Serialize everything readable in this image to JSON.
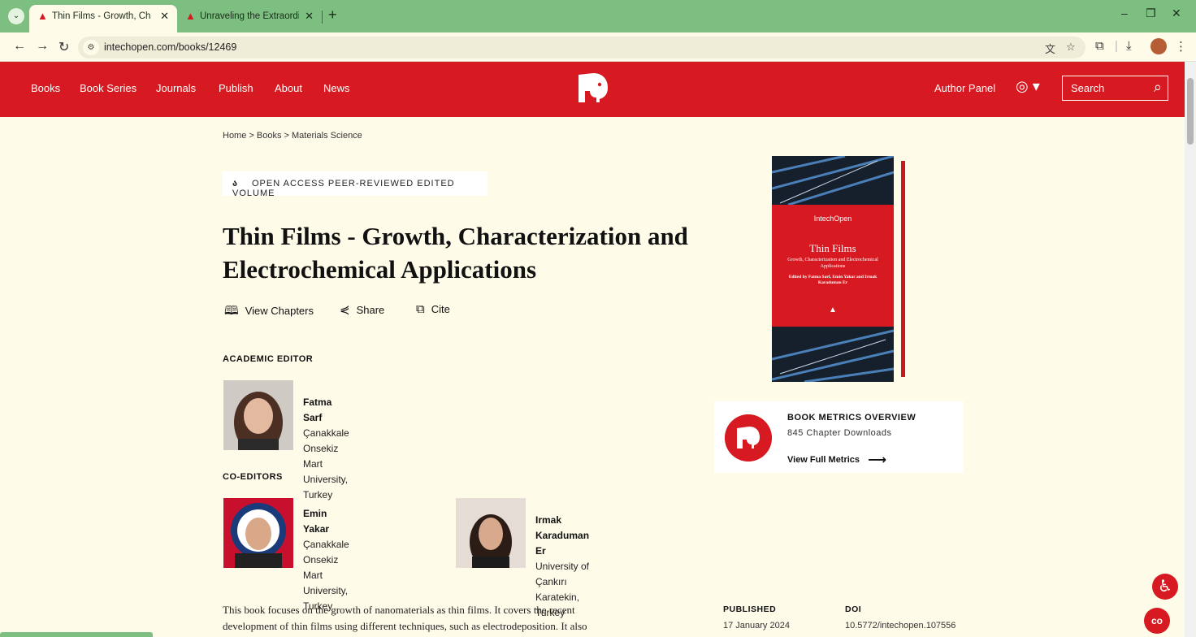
{
  "browser": {
    "tabs": [
      {
        "title": "Thin Films - Growth, Characteri",
        "active": true
      },
      {
        "title": "Unraveling the Extraordinary Ac",
        "active": false
      }
    ],
    "new_tab": "+",
    "url": "intechopen.com/books/12469",
    "window_controls": {
      "minimize": "–",
      "restore": "❐",
      "close": "✕"
    }
  },
  "site": {
    "nav": [
      "Books",
      "Book Series",
      "Journals",
      "Publish",
      "About",
      "News"
    ],
    "author_panel": "Author Panel",
    "search_placeholder": "Search"
  },
  "breadcrumb": "Home > Books > Materials Science",
  "badge": "OPEN ACCESS PEER-REVIEWED EDITED VOLUME",
  "title_line1": "Thin Films - Growth, Characterization and",
  "title_line2": "Electrochemical Applications",
  "actions": {
    "chapters": "View Chapters",
    "share": "Share",
    "cite": "Cite"
  },
  "academic_editor_label": "ACADEMIC EDITOR",
  "academic_editor": {
    "name": "Fatma Sarf",
    "affiliation_line1": "Çanakkale Onsekiz Mart University,",
    "affiliation_line2": "Turkey"
  },
  "co_editors_label": "CO-EDITORS",
  "co_editors": [
    {
      "name": "Emin Yakar",
      "line1": "Çanakkale Onsekiz Mart",
      "line2": "University,",
      "line3": "Turkey"
    },
    {
      "name": "Irmak Karaduman Er",
      "line1": "University of Çankırı Karatekin,",
      "line2": "Turkey"
    }
  ],
  "cover": {
    "publisher": "IntechOpen",
    "title": "Thin Films",
    "subtitle": "Growth, Characterization and Electrochemical Applications",
    "editors": "Edited by Fatma Sarf, Emin Yakar and Irmak Karaduman Er"
  },
  "metrics": {
    "title": "BOOK METRICS OVERVIEW",
    "downloads": "845 Chapter Downloads",
    "link": "View Full Metrics"
  },
  "description_line1": "This book focuses on the growth of nanomaterials as thin films. It covers the recent",
  "description_line2": "development of thin films using different techniques, such as electrodeposition. It also",
  "published_label": "PUBLISHED",
  "published_value": "17 January 2024",
  "doi_label": "DOI",
  "doi_value": "10.5772/intechopen.107556",
  "colors": {
    "brand_red": "#d71921",
    "page_bg": "#fefbe9",
    "chrome_green": "#7cbf80"
  }
}
